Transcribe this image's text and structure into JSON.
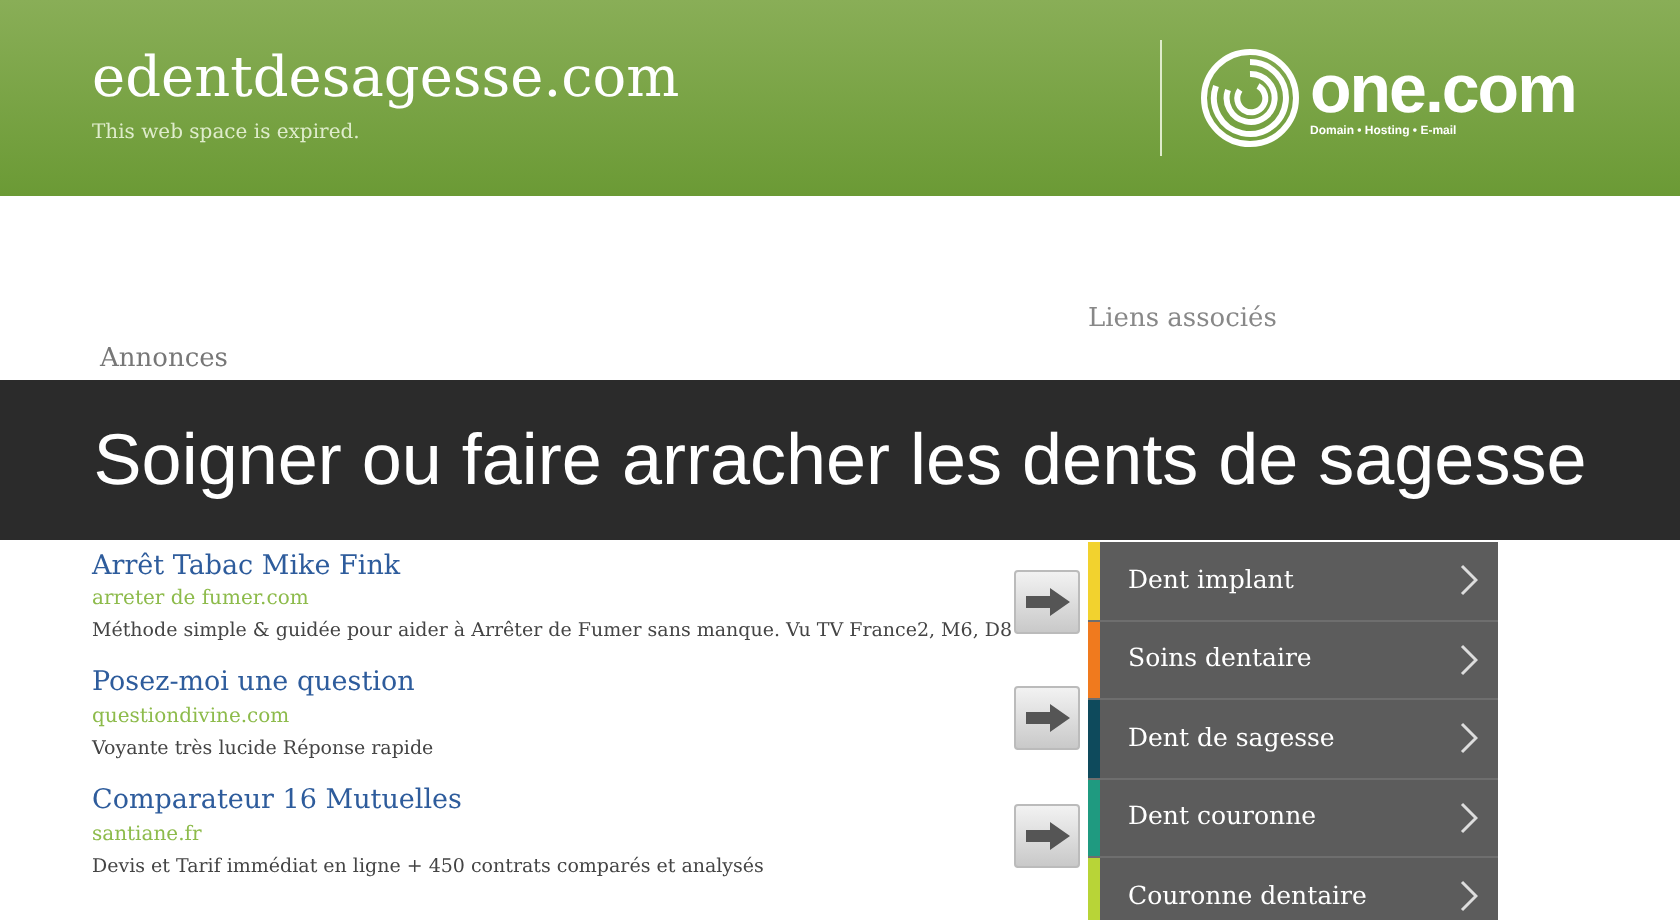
{
  "header": {
    "site_title": "edentdesagesse.com",
    "subtitle": "This web space is expired.",
    "logo_text": "one.com",
    "logo_tagline": "Domain • Hosting • E-mail"
  },
  "caption": "Soigner ou faire arracher les dents de sagesse",
  "ads": {
    "heading": "Annonces",
    "items": [
      {
        "title": "Arrêt Tabac Mike Fink",
        "url": "arreter de fumer.com",
        "description": "Méthode simple & guidée pour aider à Arrêter de Fumer sans manque. Vu TV France2, M6, D8"
      },
      {
        "title": "Posez-moi une question",
        "url": "questiondivine.com",
        "description": "Voyante très lucide Réponse rapide"
      },
      {
        "title": "Comparateur 16 Mutuelles",
        "url": "santiane.fr",
        "description": "Devis et Tarif immédiat en ligne + 450 contrats comparés et analysés"
      }
    ]
  },
  "related": {
    "heading": "Liens associés",
    "items": [
      {
        "label": "Dent implant",
        "color": "#f2d22e"
      },
      {
        "label": "Soins dentaire",
        "color": "#f07a1e"
      },
      {
        "label": "Dent de sagesse",
        "color": "#0e4a5c"
      },
      {
        "label": "Dent couronne",
        "color": "#1f9a80"
      },
      {
        "label": "Couronne dentaire",
        "color": "#b8d437"
      }
    ]
  }
}
